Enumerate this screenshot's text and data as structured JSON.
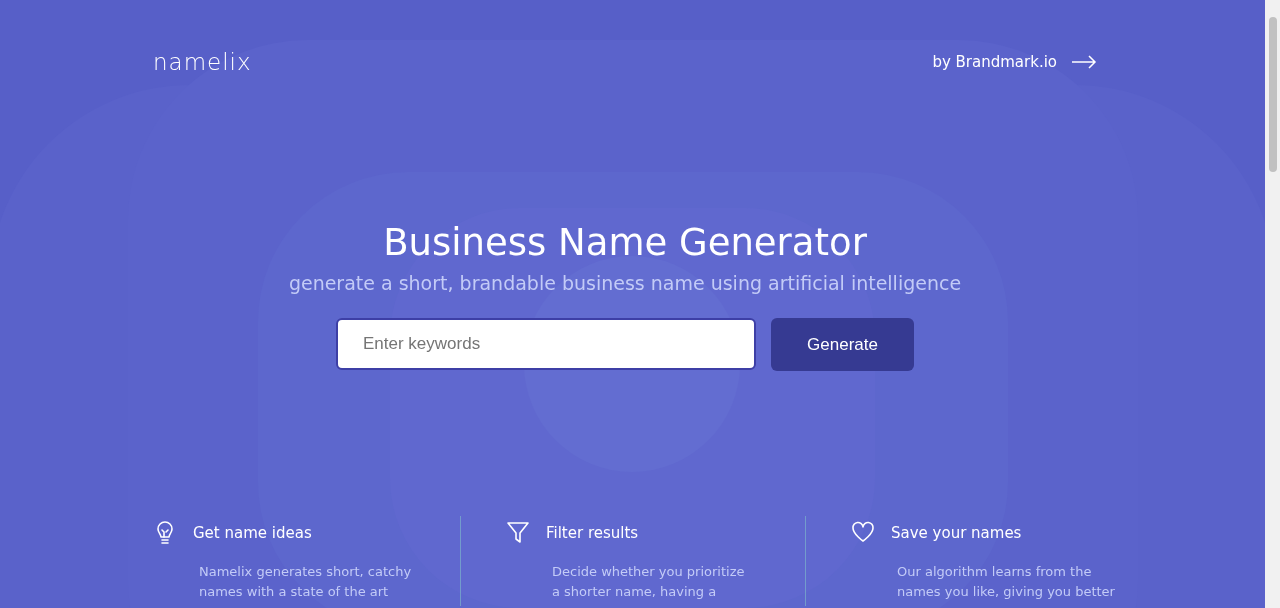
{
  "header": {
    "logo": "namelix",
    "link": "by Brandmark.io"
  },
  "hero": {
    "title": "Business Name Generator",
    "subtitle": "generate a short, brandable business name using artificial intelligence"
  },
  "search": {
    "placeholder": "Enter keywords",
    "button": "Generate"
  },
  "features": [
    {
      "kind": "bulb",
      "title": "Get name ideas",
      "text": "Namelix generates short, catchy names with a state of the art"
    },
    {
      "kind": "filter",
      "title": "Filter results",
      "text": "Decide whether you prioritize a shorter name, having a"
    },
    {
      "kind": "heart",
      "title": "Save your names",
      "text": "Our algorithm learns from the names you like, giving you better"
    }
  ]
}
